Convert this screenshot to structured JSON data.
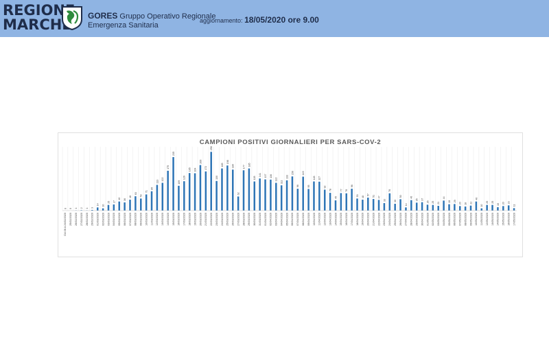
{
  "header": {
    "logo_line1": "REGIONE",
    "logo_line2": "MARCHE",
    "org_acronym": "GORES",
    "org_name_line1": "Gruppo Operativo Regionale",
    "org_name_line2": "Emergenza Sanitaria",
    "update_label": "aggiornamento:",
    "update_value": "18/05/2020 ore 9.00",
    "bg_color": "#8fb4e3"
  },
  "chart_data": {
    "type": "bar",
    "title": "CAMPIONI POSITIVI GIORNALIERI PER SARS-COV-2",
    "bar_color": "#2e75b6",
    "grid": "vertical",
    "legend": "none",
    "categories": [
      "DA 06 A 24/02/2020",
      "25/02/2020",
      "26/02/2020",
      "27/02/2020",
      "28/02/2020",
      "29/02/2020",
      "01/03/2020",
      "02/03/2020",
      "03/03/2020",
      "04/03/2020",
      "05/03/2020",
      "06/03/2020",
      "07/03/2020",
      "08/03/2020",
      "09/03/2020",
      "10/03/2020",
      "11/03/2020",
      "12/03/2020",
      "13/03/2020",
      "14/03/2020",
      "15/03/2020",
      "16/03/2020",
      "17/03/2020",
      "18/03/2020",
      "19/03/2020",
      "20/03/2020",
      "21/03/2020",
      "22/03/2020",
      "23/03/2020",
      "24/03/2020",
      "25/03/2020",
      "26/03/2020",
      "27/03/2020",
      "28/03/2020",
      "29/03/2020",
      "30/03/2020",
      "31/03/2020",
      "01/04/2020",
      "02/04/2020",
      "03/04/2020",
      "04/04/2020",
      "05/04/2020",
      "06/04/2020",
      "07/04/2020",
      "08/04/2020",
      "09/04/2020",
      "10/04/2020",
      "11/04/2020",
      "12/04/2020",
      "13/04/2020",
      "14/04/2020",
      "15/04/2020",
      "16/04/2020",
      "17/04/2020",
      "18/04/2020",
      "19/04/2020",
      "20/04/2020",
      "21/04/2020",
      "22/04/2020",
      "23/04/2020",
      "24/04/2020",
      "25/04/2020",
      "26/04/2020",
      "27/04/2020",
      "28/04/2020",
      "29/04/2020",
      "30/04/2020",
      "01/05/2020",
      "02/05/2020",
      "03/05/2020",
      "04/05/2020",
      "05/05/2020",
      "06/05/2020",
      "07/05/2020",
      "08/05/2020",
      "09/05/2020",
      "10/05/2020",
      "11/05/2020",
      "12/05/2020",
      "13/05/2020",
      "14/05/2020",
      "15/05/2020",
      "16/05/2020",
      "17/05/2020"
    ],
    "values": [
      0,
      0,
      1,
      2,
      1,
      3,
      14,
      10,
      25,
      27,
      40,
      36,
      48,
      63,
      53,
      71,
      85,
      113,
      122,
      175,
      235,
      109,
      129,
      165,
      164,
      200,
      172,
      258,
      130,
      185,
      198,
      180,
      62,
      177,
      185,
      128,
      141,
      137,
      136,
      122,
      111,
      133,
      150,
      96,
      149,
      95,
      128,
      127,
      92,
      78,
      45,
      77,
      76,
      96,
      53,
      48,
      57,
      51,
      47,
      33,
      76,
      30,
      50,
      14,
      46,
      35,
      37,
      26,
      25,
      21,
      44,
      28,
      29,
      20,
      18,
      22,
      40,
      10,
      25,
      25,
      15,
      20,
      23,
      11
    ],
    "ylim": [
      0,
      280
    ]
  }
}
